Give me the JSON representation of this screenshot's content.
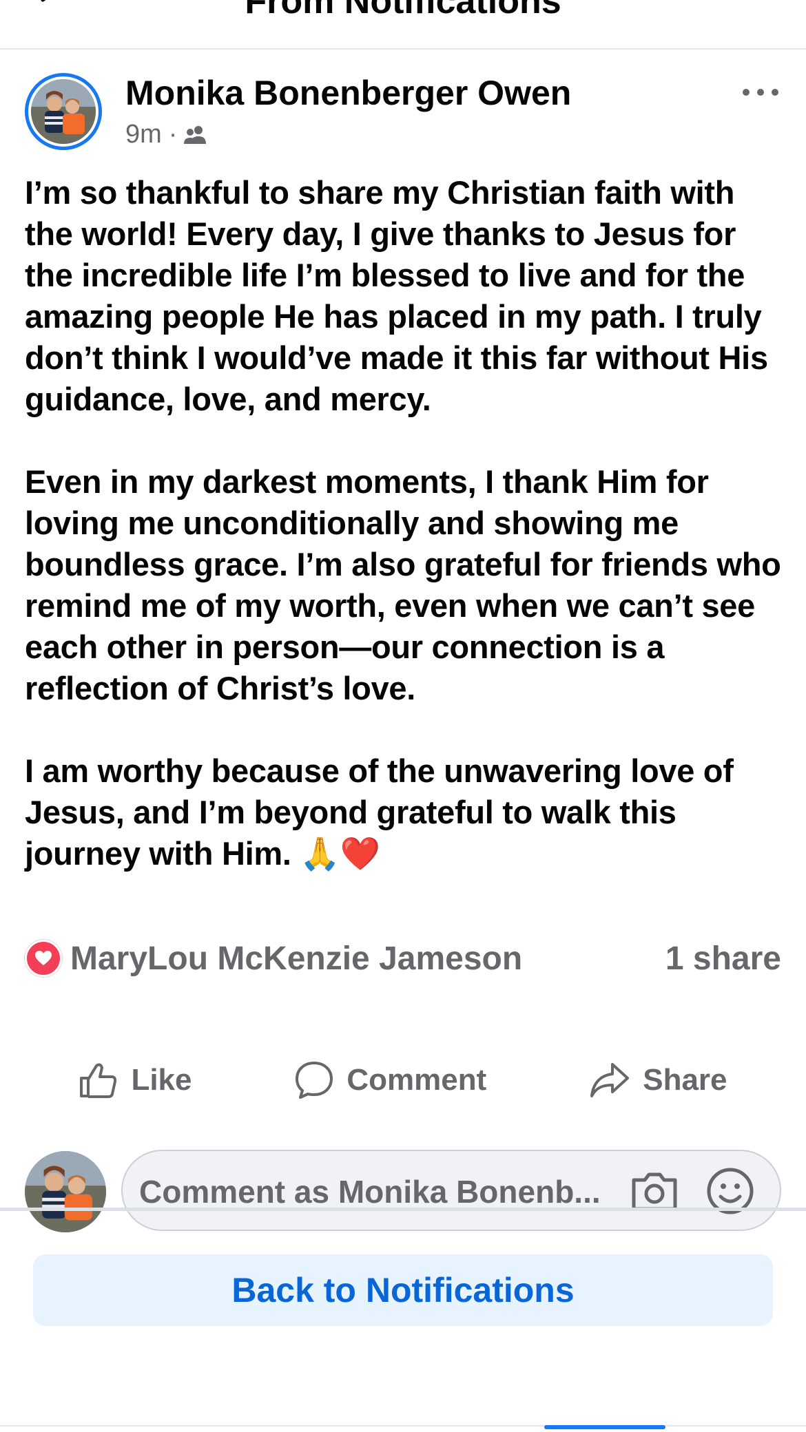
{
  "header": {
    "title": "From Notifications"
  },
  "post": {
    "author": "Monika Bonenberger Owen",
    "time": "9m",
    "separator": "·",
    "audience_icon": "friends-icon",
    "paragraphs": [
      "I’m so thankful to share my Christian faith with the world! Every day, I give thanks to Jesus for the incredible life I’m blessed to live and for the amazing people He has placed in my path. I truly don’t think I would’ve made it this far without His guidance, love, and mercy.",
      "Even in my darkest moments, I thank Him for loving me unconditionally and showing me boundless grace. I’m also grateful for friends who remind me of my worth, even when we can’t see each other in person—our connection is a reflection of Christ’s love.",
      "I am worthy because of the unwavering love of Jesus, and I’m beyond grateful to walk this journey with Him. 🙏❤️"
    ],
    "reaction_icon": "love-reaction-icon",
    "reactor": "MaryLou McKenzie Jameson",
    "shares": "1 share"
  },
  "actions": {
    "like": "Like",
    "comment": "Comment",
    "share": "Share"
  },
  "comment_input": {
    "placeholder": "Comment as Monika Bonenb..."
  },
  "footer": {
    "back_button": "Back to Notifications"
  },
  "colors": {
    "accent": "#1877f2",
    "text": "#050505",
    "secondary": "#65676b",
    "love": "#f33e58",
    "button_bg": "#e7f3ff"
  }
}
